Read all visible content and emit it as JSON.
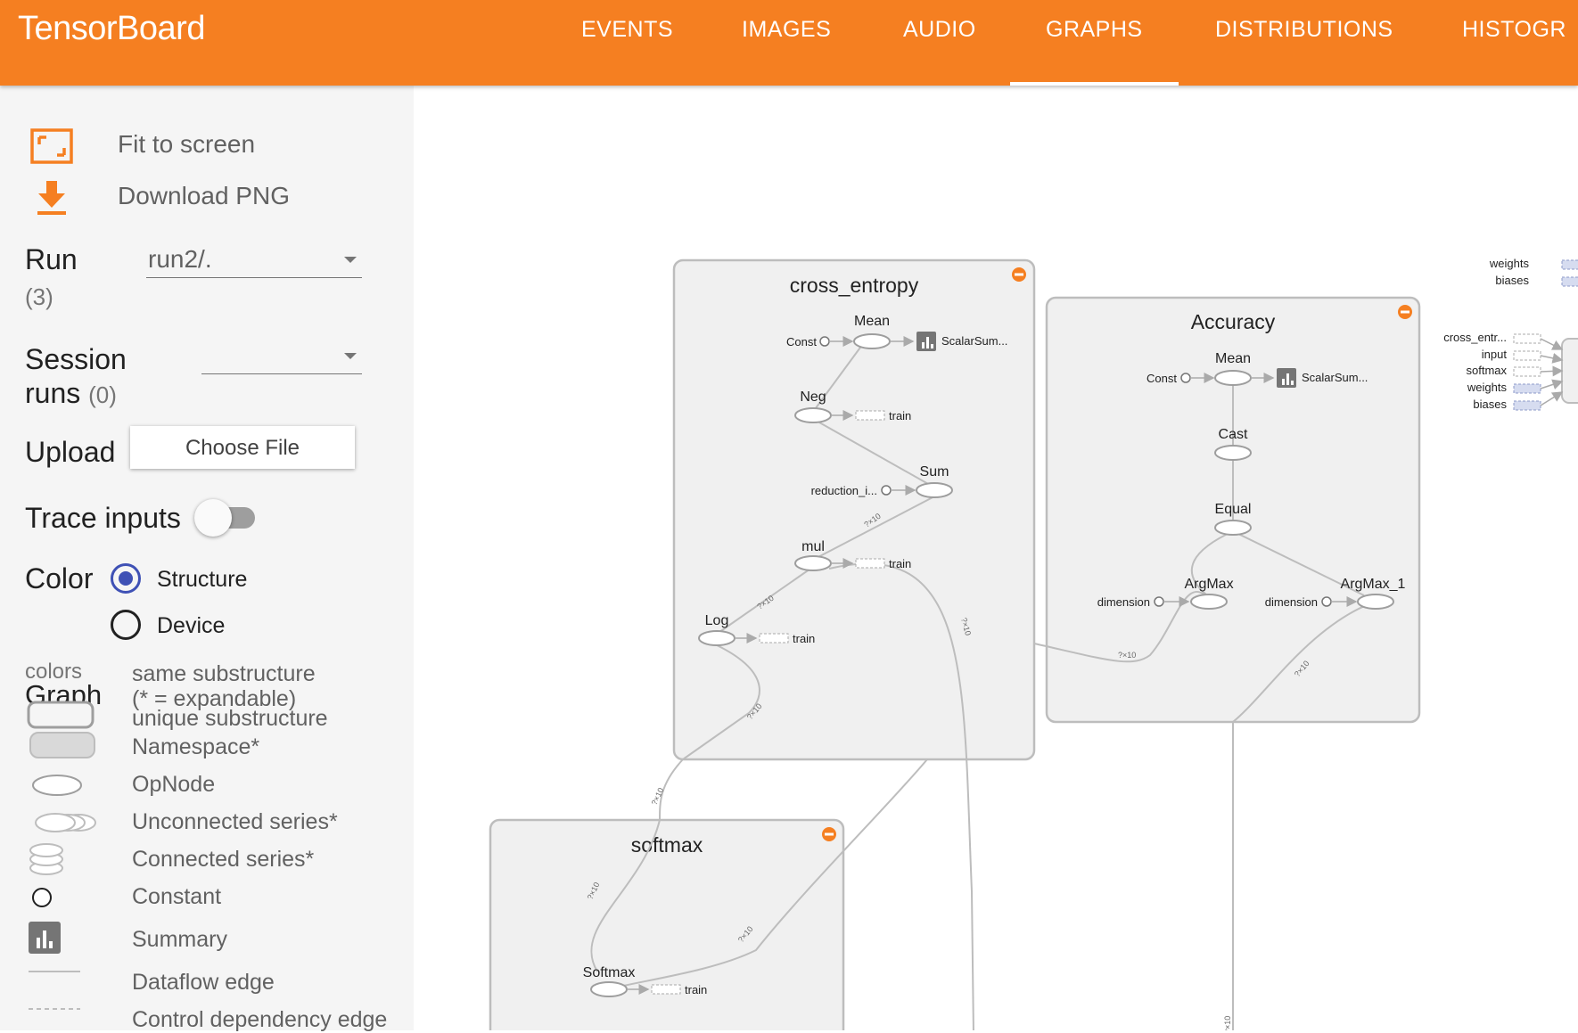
{
  "app": {
    "title": "TensorBoard"
  },
  "tabs": [
    {
      "label": "EVENTS"
    },
    {
      "label": "IMAGES"
    },
    {
      "label": "AUDIO"
    },
    {
      "label": "GRAPHS",
      "active": true
    },
    {
      "label": "DISTRIBUTIONS"
    },
    {
      "label": "HISTOGR"
    }
  ],
  "sidebar": {
    "fit_label": "Fit to screen",
    "download_label": "Download PNG",
    "run_label": "Run",
    "run_count": "(3)",
    "run_value": "run2/.",
    "session_label_1": "Session",
    "session_label_2": "runs",
    "session_count": "(0)",
    "session_value": "",
    "upload_label": "Upload",
    "choose_file": "Choose File",
    "trace_label": "Trace inputs",
    "trace_on": false,
    "color_label": "Color",
    "color_options": [
      "Structure",
      "Device"
    ],
    "color_selected": "Structure",
    "legend": {
      "colors_label": "colors",
      "graph_label": "Graph",
      "same_substructure": "same substructure",
      "expandable_note": "(* = expandable)",
      "unique_substructure": "unique substructure",
      "namespace": "Namespace*",
      "opnode": "OpNode",
      "unconnected": "Unconnected series*",
      "connected": "Connected series*",
      "constant": "Constant",
      "summary": "Summary",
      "dataflow": "Dataflow edge",
      "control": "Control dependency edge"
    }
  },
  "graph": {
    "cross_entropy": {
      "title": "cross_entropy",
      "mean": "Mean",
      "const": "Const",
      "scalar": "ScalarSum...",
      "neg": "Neg",
      "train": "train",
      "sum": "Sum",
      "reduction": "reduction_i...",
      "mul": "mul",
      "log": "Log"
    },
    "accuracy": {
      "title": "Accuracy",
      "mean": "Mean",
      "const": "Const",
      "scalar": "ScalarSum...",
      "cast": "Cast",
      "equal": "Equal",
      "argmax": "ArgMax",
      "argmax1": "ArgMax_1",
      "dimension": "dimension"
    },
    "softmax": {
      "title": "softmax",
      "node": "Softmax",
      "train": "train"
    },
    "side_inputs_top": [
      "weights",
      "biases"
    ],
    "side_inputs_mid": [
      "cross_entr...",
      "input",
      "softmax",
      "weights",
      "biases"
    ],
    "edge_label": "?×10"
  },
  "colors": {
    "header": "#f57f21",
    "accent": "#3f51b5",
    "namespace_fill": "#f0f0f0",
    "namespace_stroke": "#bdbdbd"
  }
}
